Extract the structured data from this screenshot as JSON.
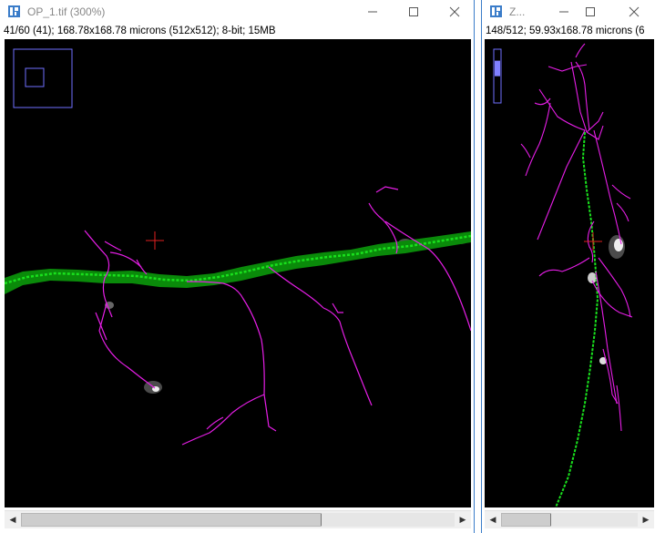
{
  "left_window": {
    "title": "OP_1.tif (300%)",
    "info": "41/60 (41); 168.78x168.78 microns (512x512); 8-bit; 15MB",
    "controls": {
      "minimize": "—",
      "maximize": "☐",
      "close": "✕"
    }
  },
  "right_window": {
    "title": "Z...",
    "info": "148/512; 59.93x168.78 microns (6",
    "controls": {
      "minimize": "—",
      "maximize": "☐",
      "close": "✕"
    },
    "slice_indicator_fraction": 0.29
  },
  "scroll": {
    "left_arrow": "◀",
    "right_arrow": "▶"
  },
  "colors": {
    "canvas_bg": "#000000",
    "trace_green": "#19e11d",
    "path_dark_green": "#0a8a0a",
    "branch_magenta": "#e61ee6",
    "crosshair": "#e02020",
    "navigator": "#7070ff",
    "window_border": "#3a7cc9"
  },
  "icons": {
    "app": "imagej-icon",
    "crosshair": "crosshair-icon"
  }
}
